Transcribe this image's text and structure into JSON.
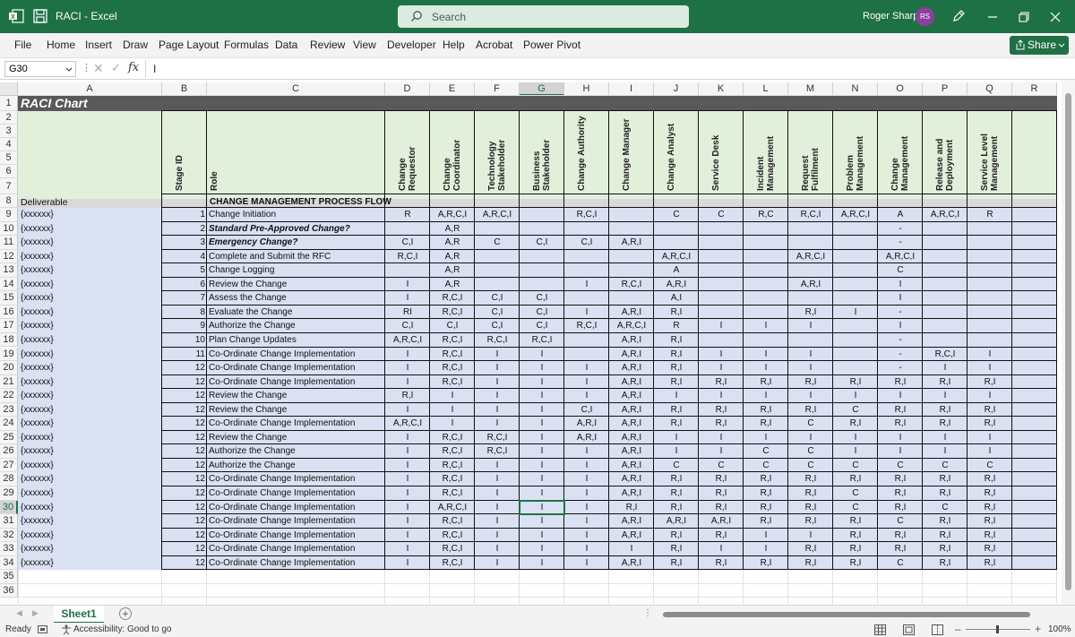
{
  "app": {
    "title": "RACI  -  Excel",
    "search_placeholder": "Search",
    "user_name": "Roger Sharp",
    "user_initials": "RS"
  },
  "ribbon": {
    "menu": [
      "File",
      "Home",
      "Insert",
      "Draw",
      "Page Layout",
      "Formulas",
      "Data",
      "Review",
      "View",
      "Developer",
      "Help",
      "Acrobat",
      "Power Pivot"
    ],
    "share_label": "Share"
  },
  "formula_bar": {
    "name_box": "G30",
    "fx": "fx",
    "content": "I"
  },
  "grid": {
    "columns": [
      "A",
      "B",
      "C",
      "D",
      "E",
      "F",
      "G",
      "H",
      "I",
      "J",
      "K",
      "L",
      "M",
      "N",
      "O",
      "P",
      "Q",
      "R"
    ],
    "selected_column": "G",
    "selected_row": 30,
    "row_numbers": [
      1,
      2,
      3,
      4,
      5,
      6,
      7,
      8,
      9,
      10,
      11,
      12,
      13,
      14,
      15,
      16,
      17,
      18,
      19,
      20,
      21,
      22,
      23,
      24,
      25,
      26,
      27,
      28,
      29,
      30,
      31,
      32,
      33,
      34,
      35,
      36
    ]
  },
  "raci": {
    "title": "RACI Chart",
    "header_b": "Stage ID",
    "header_c": "Role",
    "deliverable_label": "Deliverable",
    "process_flow_label": "CHANGE MANAGEMENT PROCESS FLOW",
    "roles": [
      "Change Requestor",
      "Change Coordinator",
      "Technology Stakeholder",
      "Business Stakeholder",
      "Change Authority",
      "Change Manager",
      "Change Analyst",
      "Service Desk",
      "Incident Management",
      "Request Fulfilment",
      "Problem Management",
      "Change Management",
      "Release and Deployment",
      "Service Level Management"
    ],
    "rows": [
      {
        "a": "{xxxxxx}",
        "b": "1",
        "c": "Change Initiation",
        "style": "",
        "v": [
          "R",
          "A,R,C,I",
          "A,R,C,I",
          "",
          "R,C,I",
          "",
          "C",
          "C",
          "R,C",
          "R,C,I",
          "A,R,C,I",
          "A",
          "A,R,C,I",
          "R"
        ]
      },
      {
        "a": "{xxxxxx}",
        "b": "2",
        "c": "Standard Pre-Approved Change?",
        "style": "bi",
        "v": [
          "",
          "A,R",
          "",
          "",
          "",
          "",
          "",
          "",
          "",
          "",
          "",
          "-",
          "",
          ""
        ]
      },
      {
        "a": "{xxxxxx}",
        "b": "3",
        "c": "Emergency Change?",
        "style": "bi",
        "v": [
          "C,I",
          "A,R",
          "C",
          "C,I",
          "C,I",
          "A,R,I",
          "",
          "",
          "",
          "",
          "",
          "-",
          "",
          ""
        ]
      },
      {
        "a": "{xxxxxx}",
        "b": "4",
        "c": "Complete and Submit the RFC",
        "style": "",
        "v": [
          "R,C,I",
          "A,R",
          "",
          "",
          "",
          "",
          "A,R,C,I",
          "",
          "",
          "A,R,C,I",
          "",
          "A,R,C,I",
          "",
          ""
        ]
      },
      {
        "a": "{xxxxxx}",
        "b": "5",
        "c": "Change Logging",
        "style": "",
        "v": [
          "",
          "A,R",
          "",
          "",
          "",
          "",
          "A",
          "",
          "",
          "",
          "",
          "C",
          "",
          ""
        ]
      },
      {
        "a": "{xxxxxx}",
        "b": "6",
        "c": "Review the Change",
        "style": "",
        "v": [
          "I",
          "A,R",
          "",
          "",
          "I",
          "R,C,I",
          "A,R,I",
          "",
          "",
          "A,R,I",
          "",
          "I",
          "",
          ""
        ]
      },
      {
        "a": "{xxxxxx}",
        "b": "7",
        "c": "Assess the Change",
        "style": "",
        "v": [
          "I",
          "R,C,I",
          "C,I",
          "C,I",
          "",
          "",
          "A,I",
          "",
          "",
          "",
          "",
          "I",
          "",
          ""
        ]
      },
      {
        "a": "{xxxxxx}",
        "b": "8",
        "c": "Evaluate the Change",
        "style": "",
        "v": [
          "RI",
          "R,C,I",
          "C,I",
          "C,I",
          "I",
          "A,R,I",
          "R,I",
          "",
          "",
          "R,I",
          "I",
          "-",
          "",
          ""
        ]
      },
      {
        "a": "{xxxxxx}",
        "b": "9",
        "c": "Authorize the Change",
        "style": "",
        "v": [
          "C,I",
          "C,I",
          "C,I",
          "C,I",
          "R,C,I",
          "A,R,C,I",
          "R",
          "I",
          "I",
          "I",
          "",
          "I",
          "",
          ""
        ]
      },
      {
        "a": "{xxxxxx}",
        "b": "10",
        "c": "Plan Change Updates",
        "style": "",
        "v": [
          "A,R,C,I",
          "R,C,I",
          "R,C,I",
          "R,C,I",
          "",
          "A,R,I",
          "R,I",
          "",
          "",
          "",
          "",
          "-",
          "",
          ""
        ]
      },
      {
        "a": "{xxxxxx}",
        "b": "11",
        "c": "Co-Ordinate Change Implementation",
        "style": "",
        "v": [
          "I",
          "R,C,I",
          "I",
          "I",
          "",
          "A,R,I",
          "R,I",
          "I",
          "I",
          "I",
          "",
          "-",
          "R,C,I",
          "I"
        ]
      },
      {
        "a": "{xxxxxx}",
        "b": "12",
        "c": "Co-Ordinate Change Implementation",
        "style": "",
        "v": [
          "I",
          "R,C,I",
          "I",
          "I",
          "I",
          "A,R,I",
          "R,I",
          "I",
          "I",
          "I",
          "",
          "-",
          "I",
          "I"
        ]
      },
      {
        "a": "{xxxxxx}",
        "b": "12",
        "c": "Co-Ordinate Change Implementation",
        "style": "",
        "v": [
          "I",
          "R,C,I",
          "I",
          "I",
          "I",
          "A,R,I",
          "R,I",
          "R,I",
          "R,I",
          "R,I",
          "R,I",
          "R,I",
          "R,I",
          "R,I"
        ]
      },
      {
        "a": "{xxxxxx}",
        "b": "12",
        "c": "Review the Change",
        "style": "",
        "v": [
          "R,I",
          "I",
          "I",
          "I",
          "I",
          "A,R,I",
          "I",
          "I",
          "I",
          "I",
          "I",
          "I",
          "I",
          "I"
        ]
      },
      {
        "a": "{xxxxxx}",
        "b": "12",
        "c": "Review the Change",
        "style": "",
        "v": [
          "I",
          "I",
          "I",
          "I",
          "C,I",
          "A,R,I",
          "R,I",
          "R,I",
          "R,I",
          "R,I",
          "C",
          "R,I",
          "R,I",
          "R,I"
        ]
      },
      {
        "a": "{xxxxxx}",
        "b": "12",
        "c": "Co-Ordinate Change Implementation",
        "style": "",
        "v": [
          "A,R,C,I",
          "I",
          "I",
          "I",
          "A,R,I",
          "A,R,I",
          "R,I",
          "R,I",
          "R,I",
          "C",
          "R,I",
          "R,I",
          "R,I",
          "R,I"
        ]
      },
      {
        "a": "{xxxxxx}",
        "b": "12",
        "c": "Review the Change",
        "style": "",
        "v": [
          "I",
          "R,C,I",
          "R,C,I",
          "I",
          "A,R,I",
          "A,R,I",
          "I",
          "I",
          "I",
          "I",
          "I",
          "I",
          "I",
          "I"
        ]
      },
      {
        "a": "{xxxxxx}",
        "b": "12",
        "c": "Authorize the Change",
        "style": "",
        "v": [
          "I",
          "R,C,I",
          "R,C,I",
          "I",
          "I",
          "A,R,I",
          "I",
          "I",
          "C",
          "C",
          "I",
          "I",
          "I",
          "I"
        ]
      },
      {
        "a": "{xxxxxx}",
        "b": "12",
        "c": "Authorize the Change",
        "style": "",
        "v": [
          "I",
          "R,C,I",
          "I",
          "I",
          "I",
          "A,R,I",
          "C",
          "C",
          "C",
          "C",
          "C",
          "C",
          "C",
          "C"
        ]
      },
      {
        "a": "{xxxxxx}",
        "b": "12",
        "c": "Co-Ordinate Change Implementation",
        "style": "",
        "v": [
          "I",
          "R,C,I",
          "I",
          "I",
          "I",
          "A,R,I",
          "R,I",
          "R,I",
          "R,I",
          "R,I",
          "R,I",
          "R,I",
          "R,I",
          "R,I"
        ]
      },
      {
        "a": "{xxxxxx}",
        "b": "12",
        "c": "Co-Ordinate Change Implementation",
        "style": "",
        "v": [
          "I",
          "R,C,I",
          "I",
          "I",
          "I",
          "A,R,I",
          "R,I",
          "R,I",
          "R,I",
          "R,I",
          "C",
          "R,I",
          "R,I",
          "R,I"
        ]
      },
      {
        "a": "{xxxxxx}",
        "b": "12",
        "c": "Co-Ordinate Change Implementation",
        "style": "",
        "v": [
          "I",
          "A,R,C,I",
          "I",
          "I",
          "I",
          "R,I",
          "R,I",
          "R,I",
          "R,I",
          "R,I",
          "C",
          "R,I",
          "C",
          "R,I"
        ]
      },
      {
        "a": "{xxxxxx}",
        "b": "12",
        "c": "Co-Ordinate Change Implementation",
        "style": "",
        "v": [
          "I",
          "R,C,I",
          "I",
          "I",
          "I",
          "A,R,I",
          "A,R,I",
          "A,R,I",
          "R,I",
          "R,I",
          "R,I",
          "C",
          "R,I",
          "R,I"
        ]
      },
      {
        "a": "{xxxxxx}",
        "b": "12",
        "c": "Co-Ordinate Change Implementation",
        "style": "",
        "v": [
          "I",
          "R,C,I",
          "I",
          "I",
          "I",
          "A,R,I",
          "R,I",
          "R,I",
          "I",
          "I",
          "R,I",
          "R,I",
          "R,I",
          "R,I"
        ]
      },
      {
        "a": "{xxxxxx}",
        "b": "12",
        "c": "Co-Ordinate Change Implementation",
        "style": "",
        "v": [
          "I",
          "R,C,I",
          "I",
          "I",
          "I",
          "I",
          "R,I",
          "I",
          "I",
          "R,I",
          "R,I",
          "R,I",
          "R,I",
          "R,I"
        ]
      },
      {
        "a": "{xxxxxx}",
        "b": "12",
        "c": "Co-Ordinate Change Implementation",
        "style": "",
        "v": [
          "I",
          "R,C,I",
          "I",
          "I",
          "I",
          "A,R,I",
          "R,I",
          "R,I",
          "R,I",
          "R,I",
          "R,I",
          "C",
          "R,I",
          "R,I"
        ]
      }
    ]
  },
  "tabs": {
    "sheet_name": "Sheet1",
    "add_sheet": "+"
  },
  "status": {
    "ready": "Ready",
    "accessibility": "Accessibility: Good to go",
    "zoom": "100%"
  }
}
